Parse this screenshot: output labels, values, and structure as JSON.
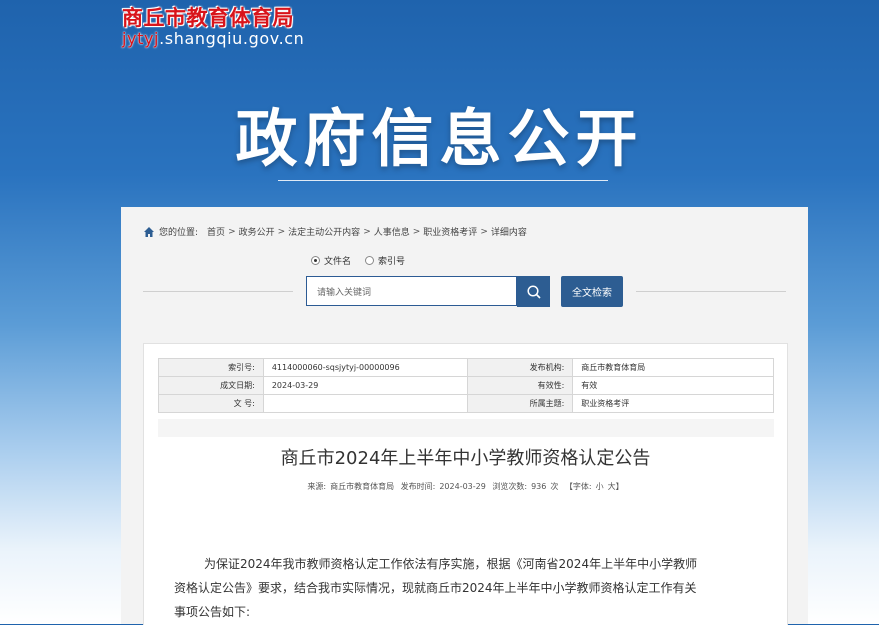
{
  "site": {
    "name": "商丘市教育体育局",
    "domain_red": "jytyj",
    "domain_rest": ".shangqiu.gov.cn"
  },
  "hero": {
    "title": "政府信息公开"
  },
  "breadcrumb": {
    "prefix": "您的位置:",
    "items": [
      "首页",
      "政务公开",
      "法定主动公开内容",
      "人事信息",
      "职业资格考评",
      "详细内容"
    ],
    "separator": ">"
  },
  "search": {
    "options": [
      "文件名",
      "索引号"
    ],
    "selected": "文件名",
    "placeholder": "请输入关键词",
    "fulltext_label": "全文检索"
  },
  "meta": {
    "index_label": "索引号:",
    "index_value": "4114000060-sqsjytyj-00000096",
    "publisher_label": "发布机构:",
    "publisher_value": "商丘市教育体育局",
    "date_label": "成文日期:",
    "date_value": "2024-03-29",
    "validity_label": "有效性:",
    "validity_value": "有效",
    "docno_label": "文 号:",
    "docno_value": "",
    "topic_label": "所属主题:",
    "topic_value": "职业资格考评"
  },
  "article": {
    "title": "商丘市2024年上半年中小学教师资格认定公告",
    "source_label": "来源:",
    "source_value": "商丘市教育体育局",
    "time_label": "发布时间:",
    "time_value": "2024-03-29",
    "views_label": "浏览次数:",
    "views_value": "936",
    "views_unit": "次",
    "font_label": "【字体:",
    "font_small": "小",
    "font_large": "大】",
    "body_lines": [
      "为保证2024年我市教师资格认定工作依法有序实施，根据《河南省2024年上半年中小学教师",
      "资格认定公告》要求，结合我市实际情况，现就商丘市2024年上半年中小学教师资格认定工作有关",
      "事项公告如下:"
    ]
  },
  "colors": {
    "brand_red": "#d8141b",
    "button_blue": "#2d5d92"
  }
}
